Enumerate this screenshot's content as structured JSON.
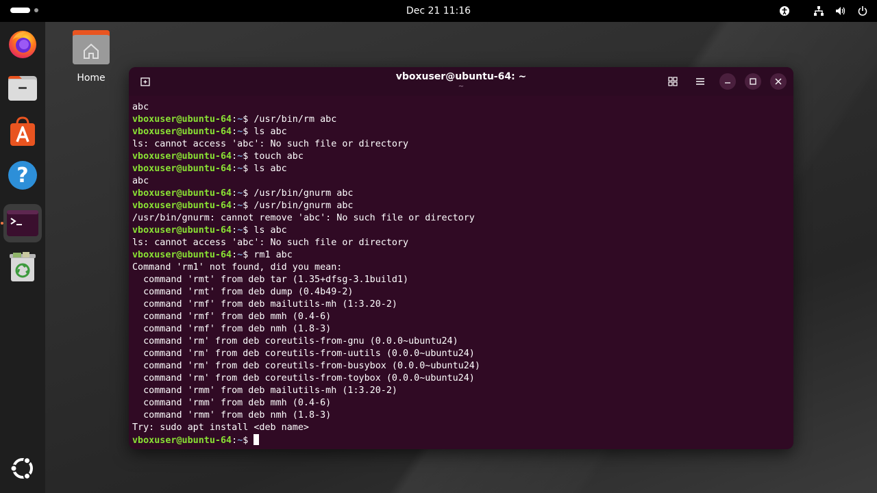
{
  "topbar": {
    "clock": "Dec 21  11:16"
  },
  "desktop": {
    "home_label": "Home"
  },
  "dock": {
    "items": [
      "firefox-icon",
      "files-icon",
      "app-center-icon",
      "help-icon",
      "terminal-icon",
      "trash-icon"
    ],
    "show_apps": "ubuntu-logo-icon"
  },
  "terminal": {
    "title": "vboxuser@ubuntu-64: ~",
    "subtitle": "~",
    "prompt_user": "vboxuser@ubuntu-64",
    "prompt_sep": ":",
    "prompt_path": "~",
    "prompt_end": "$ ",
    "lines": [
      {
        "type": "out",
        "text": "abc"
      },
      {
        "type": "cmd",
        "text": "/usr/bin/rm abc"
      },
      {
        "type": "cmd",
        "text": "ls abc"
      },
      {
        "type": "out",
        "text": "ls: cannot access 'abc': No such file or directory"
      },
      {
        "type": "cmd",
        "text": "touch abc"
      },
      {
        "type": "cmd",
        "text": "ls abc"
      },
      {
        "type": "out",
        "text": "abc"
      },
      {
        "type": "cmd",
        "text": "/usr/bin/gnurm abc"
      },
      {
        "type": "cmd",
        "text": "/usr/bin/gnurm abc"
      },
      {
        "type": "out",
        "text": "/usr/bin/gnurm: cannot remove 'abc': No such file or directory"
      },
      {
        "type": "cmd",
        "text": "ls abc"
      },
      {
        "type": "out",
        "text": "ls: cannot access 'abc': No such file or directory"
      },
      {
        "type": "cmd",
        "text": "rm1 abc"
      },
      {
        "type": "out",
        "text": "Command 'rm1' not found, did you mean:"
      },
      {
        "type": "out",
        "text": "  command 'rmt' from deb tar (1.35+dfsg-3.1build1)"
      },
      {
        "type": "out",
        "text": "  command 'rmt' from deb dump (0.4b49-2)"
      },
      {
        "type": "out",
        "text": "  command 'rmf' from deb mailutils-mh (1:3.20-2)"
      },
      {
        "type": "out",
        "text": "  command 'rmf' from deb mmh (0.4-6)"
      },
      {
        "type": "out",
        "text": "  command 'rmf' from deb nmh (1.8-3)"
      },
      {
        "type": "out",
        "text": "  command 'rm' from deb coreutils-from-gnu (0.0.0~ubuntu24)"
      },
      {
        "type": "out",
        "text": "  command 'rm' from deb coreutils-from-uutils (0.0.0~ubuntu24)"
      },
      {
        "type": "out",
        "text": "  command 'rm' from deb coreutils-from-busybox (0.0.0~ubuntu24)"
      },
      {
        "type": "out",
        "text": "  command 'rm' from deb coreutils-from-toybox (0.0.0~ubuntu24)"
      },
      {
        "type": "out",
        "text": "  command 'rmm' from deb mailutils-mh (1:3.20-2)"
      },
      {
        "type": "out",
        "text": "  command 'rmm' from deb mmh (0.4-6)"
      },
      {
        "type": "out",
        "text": "  command 'rmm' from deb nmh (1.8-3)"
      },
      {
        "type": "out",
        "text": "Try: sudo apt install <deb name>"
      },
      {
        "type": "prompt",
        "text": ""
      }
    ]
  },
  "colors": {
    "terminal_bg": "#300a24",
    "prompt_user": "#8ae234",
    "prompt_path": "#729fcf",
    "accent": "#f07746"
  }
}
